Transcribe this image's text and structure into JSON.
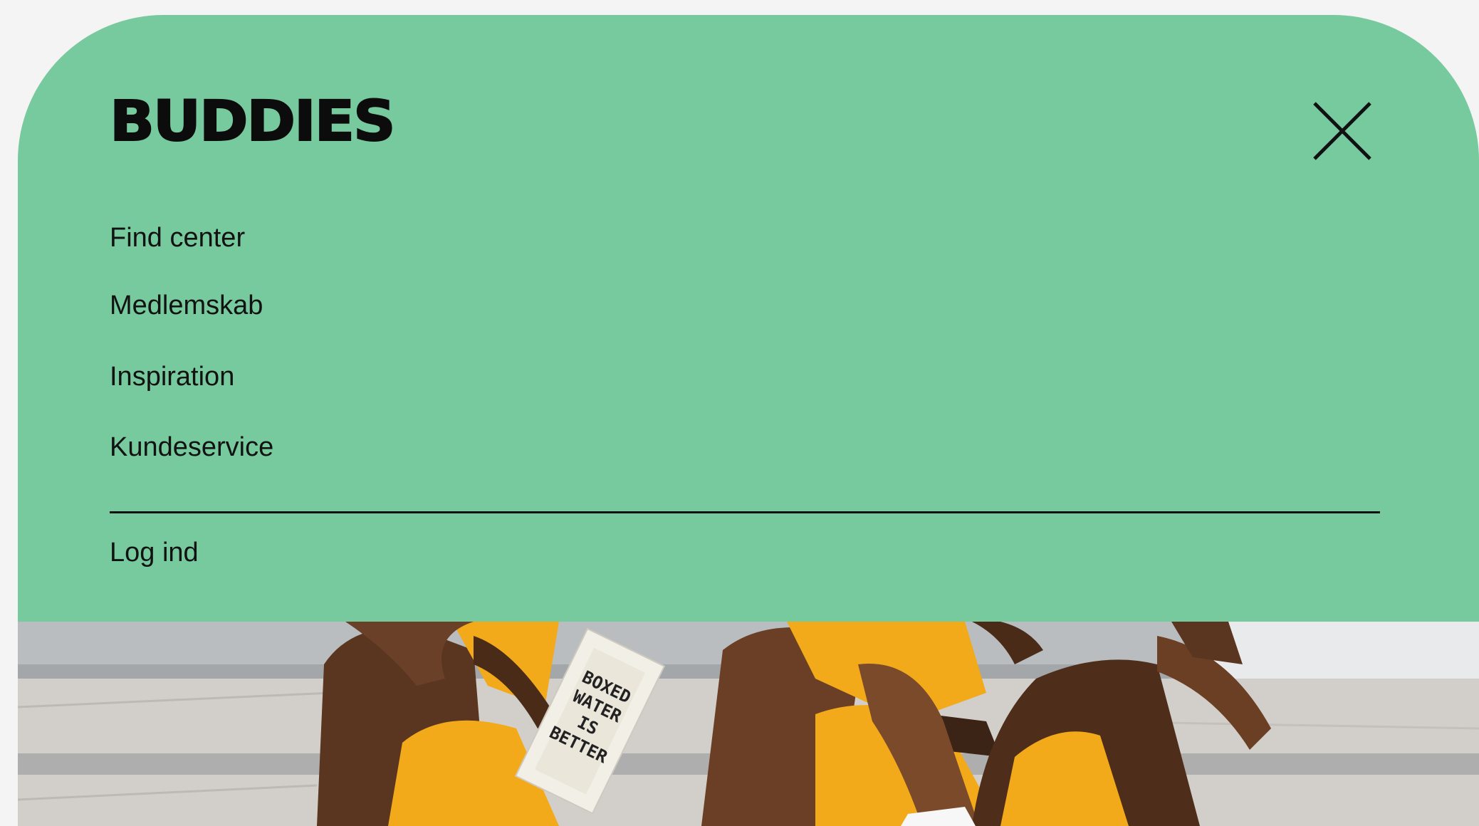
{
  "brand": {
    "logo_text": "BUDDIES"
  },
  "menu": {
    "close_icon": "close-icon",
    "items": [
      {
        "label": "Find center"
      },
      {
        "label": "Medlemskab"
      },
      {
        "label": "Inspiration"
      },
      {
        "label": "Kundeservice"
      }
    ],
    "login_label": "Log ind"
  },
  "colors": {
    "menu_background": "#77c99e",
    "text": "#121212",
    "accent_outfit": "#f2a91a"
  },
  "hero_image": {
    "carton_text": [
      "BOXED",
      "WATER",
      "IS",
      "BETTER"
    ]
  }
}
